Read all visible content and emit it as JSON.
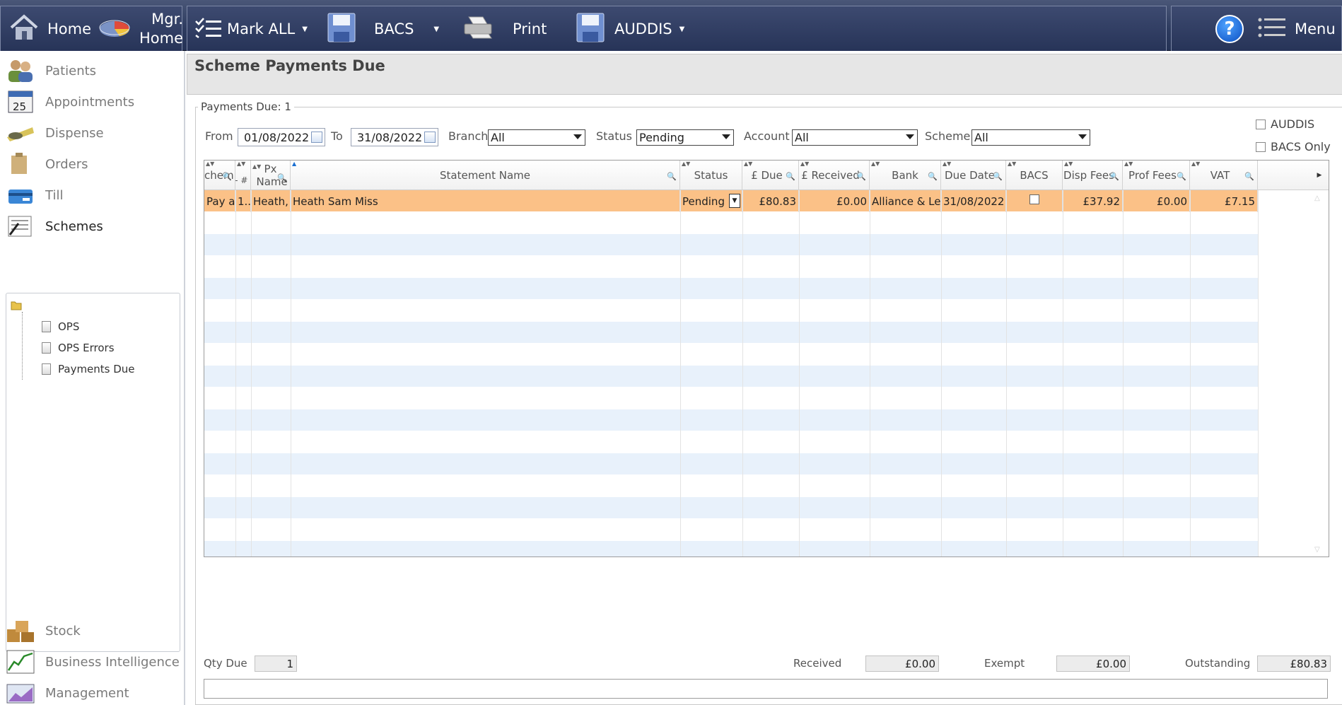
{
  "toolbar": {
    "home": "Home",
    "mgr_home": [
      "Mgr.",
      "Home"
    ],
    "mark_all": "Mark ALL",
    "bacs": "BACS",
    "print": "Print",
    "auddis": "AUDDIS",
    "help": "?",
    "menu": "Menu"
  },
  "sidebar": {
    "items": [
      {
        "label": "Patients",
        "icon": "patients-icon"
      },
      {
        "label": "Appointments",
        "icon": "calendar-icon"
      },
      {
        "label": "Dispense",
        "icon": "glasses-icon"
      },
      {
        "label": "Orders",
        "icon": "orders-icon"
      },
      {
        "label": "Till",
        "icon": "till-icon"
      },
      {
        "label": "Schemes",
        "icon": "schemes-icon"
      }
    ],
    "tree": [
      "OPS",
      "OPS Errors",
      "Payments Due"
    ],
    "bottom_items": [
      {
        "label": "Stock",
        "icon": "stock-icon"
      },
      {
        "label": "Business Intelligence",
        "icon": "chart-icon"
      },
      {
        "label": "Management",
        "icon": "management-icon"
      }
    ]
  },
  "page": {
    "title": "Scheme Payments Due",
    "legend": "Payments Due: 1"
  },
  "filters": {
    "from_label": "From",
    "from": "01/08/2022",
    "to_label": "To",
    "to": "31/08/2022",
    "branch_label": "Branch",
    "branch": "All",
    "status_label": "Status",
    "status": "Pending",
    "account_label": "Account",
    "account": "All",
    "scheme_label": "Scheme",
    "scheme": "All",
    "auddis": "AUDDIS",
    "bacs_only": "BACS Only"
  },
  "grid": {
    "headers": [
      "chem",
      "̵ #",
      "Px Name",
      "Statement Name",
      "Status",
      "£ Due",
      "£ Received",
      "Bank",
      "Due Date",
      "BACS",
      "Disp Fees",
      "Prof Fees",
      "VAT"
    ],
    "rows": [
      {
        "scheme": "Pay a:",
        "num": "1...",
        "px_name": "Heath, S",
        "statement_name": "Heath Sam Miss",
        "status": "Pending",
        "due": "£80.83",
        "received": "£0.00",
        "bank": "Alliance & Lei",
        "due_date": "31/08/2022",
        "disp_fees": "£37.92",
        "prof_fees": "£0.00",
        "vat": "£7.15"
      }
    ]
  },
  "footer": {
    "qty_label": "Qty Due",
    "qty": "1",
    "received_label": "Received",
    "received": "£0.00",
    "exempt_label": "Exempt",
    "exempt": "£0.00",
    "outstanding_label": "Outstanding",
    "outstanding": "£80.83"
  },
  "colors": {
    "toolbar": "#2c3a5e",
    "selected_row": "#fbc187",
    "alt_row": "#e8f1fb"
  }
}
